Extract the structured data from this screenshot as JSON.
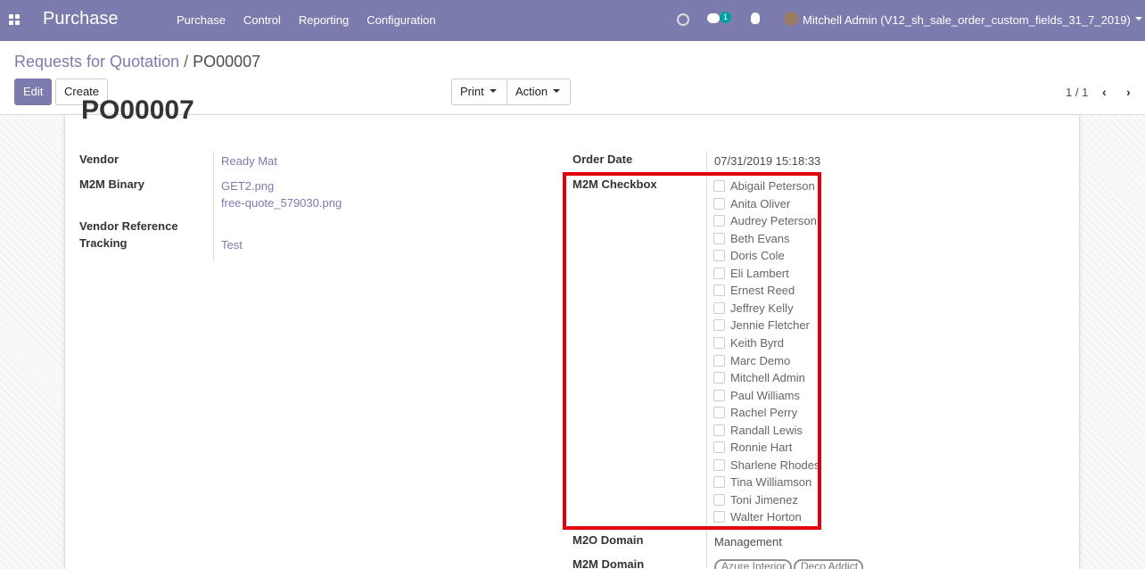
{
  "app": {
    "brand": "Purchase",
    "menu": [
      "Purchase",
      "Control",
      "Reporting",
      "Configuration"
    ],
    "chat_count": "1",
    "user": "Mitchell Admin (V12_sh_sale_order_custom_fields_31_7_2019)",
    "accent_color": "#7c7bad"
  },
  "breadcrumb": {
    "parent": "Requests for Quotation",
    "separator": "/",
    "current": "PO00007"
  },
  "buttons": {
    "edit": "Edit",
    "create": "Create",
    "print": "Print",
    "action": "Action"
  },
  "pager": {
    "value": "1 / 1"
  },
  "form": {
    "title": "PO00007",
    "vendor": {
      "label": "Vendor",
      "value": "Ready Mat"
    },
    "m2m_binary": {
      "label": "M2M Binary",
      "files": [
        "GET2.png",
        "free-quote_579030.png"
      ]
    },
    "vendor_reference": {
      "label": "Vendor Reference"
    },
    "tracking": {
      "label": "Tracking",
      "value": "Test"
    },
    "order_date": {
      "label": "Order Date",
      "value": "07/31/2019 15:18:33"
    },
    "m2m_checkbox": {
      "label": "M2M Checkbox",
      "options": [
        "Abigail Peterson",
        "Anita Oliver",
        "Audrey Peterson",
        "Beth Evans",
        "Doris Cole",
        "Eli Lambert",
        "Ernest Reed",
        "Jeffrey Kelly",
        "Jennie Fletcher",
        "Keith Byrd",
        "Marc Demo",
        "Mitchell Admin",
        "Paul Williams",
        "Rachel Perry",
        "Randall Lewis",
        "Ronnie Hart",
        "Sharlene Rhodes",
        "Tina Williamson",
        "Toni Jimenez",
        "Walter Horton"
      ]
    },
    "m2o_domain": {
      "label": "M2O Domain",
      "value": "Management"
    },
    "m2m_domain": {
      "label": "M2M Domain",
      "tags": [
        "Azure Interior",
        "Deco Addict"
      ]
    }
  }
}
